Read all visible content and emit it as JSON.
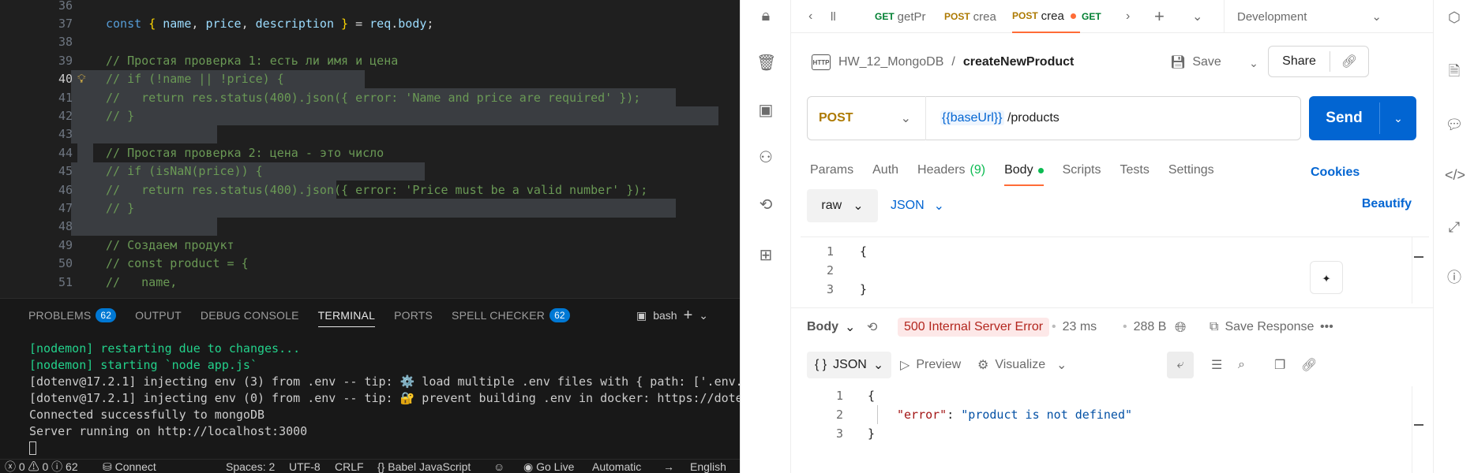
{
  "editor": {
    "lines": [
      {
        "n": "36",
        "text": ""
      },
      {
        "n": "37",
        "text": "const { name, price, description } = req.body;"
      },
      {
        "n": "38",
        "text": ""
      },
      {
        "n": "39",
        "text": "// Простая проверка 1: есть ли имя и цена"
      },
      {
        "n": "40",
        "text": "// if (!name || !price) {"
      },
      {
        "n": "41",
        "text": "//   return res.status(400).json({ error: 'Name and price are required' });"
      },
      {
        "n": "42",
        "text": "// }"
      },
      {
        "n": "43",
        "text": ""
      },
      {
        "n": "44",
        "text": "// Простая проверка 2: цена - это число"
      },
      {
        "n": "45",
        "text": "// if (isNaN(price)) {"
      },
      {
        "n": "46",
        "text": "//   return res.status(400).json({ error: 'Price must be a valid number' });"
      },
      {
        "n": "47",
        "text": "// }"
      },
      {
        "n": "48",
        "text": ""
      },
      {
        "n": "49",
        "text": "// Создаем продукт"
      },
      {
        "n": "50",
        "text": "// const product = {"
      },
      {
        "n": "51",
        "text": "//   name,"
      }
    ],
    "active_line": "40"
  },
  "panel": {
    "tabs": [
      {
        "label": "PROBLEMS",
        "badge": "62"
      },
      {
        "label": "OUTPUT"
      },
      {
        "label": "DEBUG CONSOLE"
      },
      {
        "label": "TERMINAL",
        "active": true
      },
      {
        "label": "PORTS"
      },
      {
        "label": "SPELL CHECKER",
        "badge": "62"
      }
    ],
    "shell": "bash",
    "terminal": [
      "[nodemon] restarting due to changes...",
      "[nodemon] starting `node app.js`",
      "[dotenv@17.2.1] injecting env (3) from .env -- tip: ⚙️ load multiple .env files with { path: ['.env.",
      "[dotenv@17.2.1] injecting env (0) from .env -- tip: 🔐 prevent building .env in docker: https://dote",
      "Connected successfully to mongoDB",
      "Server running on http://localhost:3000"
    ]
  },
  "statusbar": {
    "errors": "0",
    "warnings": "0",
    "info": "62",
    "connect": "Connect",
    "spaces": "Spaces: 2",
    "encoding": "UTF-8",
    "eol": "CRLF",
    "language": "Babel JavaScript",
    "golive": "Go Live",
    "automatic": "Automatic",
    "lang": "English"
  },
  "postman": {
    "tabs": [
      {
        "method": "",
        "label": "ll"
      },
      {
        "method": "GET",
        "label": "getPr"
      },
      {
        "method": "POST",
        "label": "crea"
      },
      {
        "method": "POST",
        "label": "crea",
        "active": true,
        "unsaved": true
      },
      {
        "method": "GET",
        "label": ""
      }
    ],
    "environment": "Development",
    "collection": "HW_12_MongoDB",
    "request_name": "createNewProduct",
    "save_label": "Save",
    "share_label": "Share",
    "method": "POST",
    "url_var": "{{baseUrl}}",
    "url_path": " /products",
    "send_label": "Send",
    "request_tabs": [
      {
        "label": "Params"
      },
      {
        "label": "Auth"
      },
      {
        "label": "Headers",
        "count": "(9)"
      },
      {
        "label": "Body",
        "active": true
      },
      {
        "label": "Scripts"
      },
      {
        "label": "Tests"
      },
      {
        "label": "Settings"
      }
    ],
    "cookies_label": "Cookies",
    "body_mode": "raw",
    "body_format": "JSON",
    "beautify_label": "Beautify",
    "request_body": [
      {
        "n": "1",
        "text": "{"
      },
      {
        "n": "2",
        "text": ""
      },
      {
        "n": "3",
        "text": "}"
      }
    ],
    "response": {
      "label": "Body",
      "status": "500 Internal Server Error",
      "time": "23 ms",
      "size": "288 B",
      "save_label": "Save Response",
      "format": "JSON",
      "preview_label": "Preview",
      "visualize_label": "Visualize",
      "lines": [
        {
          "n": "1",
          "text": "{"
        },
        {
          "n": "2",
          "key": "\"error\"",
          "sep": ": ",
          "value": "\"product is not defined\""
        },
        {
          "n": "3",
          "text": "}"
        }
      ]
    }
  },
  "colors": {
    "vscode_bg": "#1f1f1f",
    "postman_accent": "#ff6c37",
    "send_blue": "#0265d2",
    "error_red": "#b3261e"
  }
}
